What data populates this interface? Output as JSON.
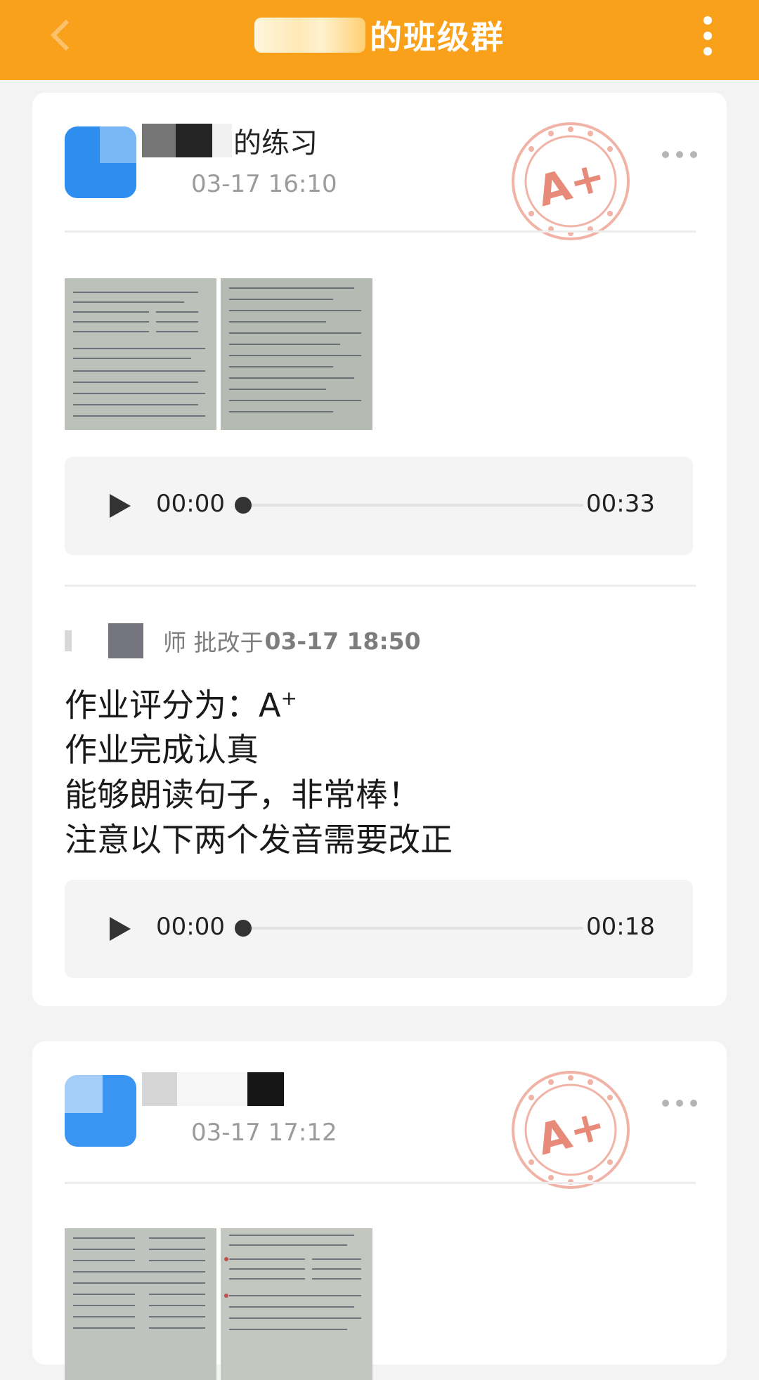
{
  "topbar": {
    "title_suffix": "的班级群",
    "back_icon": "chevron-left-icon",
    "more_icon": "more-vertical-icon",
    "background": "#f9a11b"
  },
  "posts": [
    {
      "name_suffix": "的练习",
      "time": "03-17 16:10",
      "stamp_icon": "grade-a-plus-stamp-icon",
      "stamp_text": "A+",
      "stamp_color": "#e88a7a",
      "audio": {
        "current": "00:00",
        "total": "00:33"
      },
      "review": {
        "teacher_suffix": "师 批改于",
        "time": "03-17 18:50"
      },
      "comment": {
        "line1": "作业评分为：A",
        "line1_sup": "+",
        "line2": "作业完成认真",
        "line3": "能够朗读句子，非常棒！",
        "line4": "注意以下两个发音需要改正"
      },
      "review_audio": {
        "current": "00:00",
        "total": "00:18"
      }
    },
    {
      "time": "03-17 17:12",
      "stamp_icon": "grade-a-plus-stamp-icon",
      "stamp_text": "A+"
    }
  ]
}
